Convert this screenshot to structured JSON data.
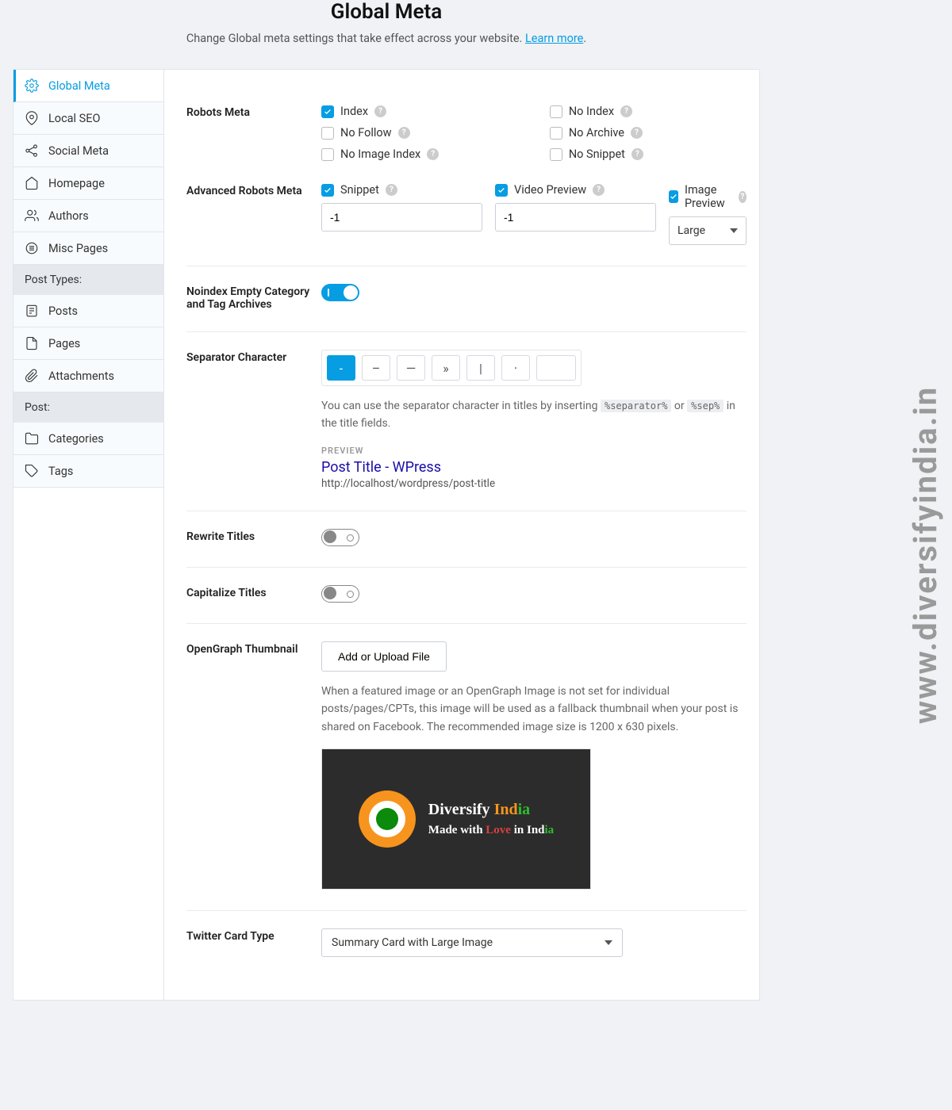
{
  "header": {
    "title": "Global Meta",
    "subtitle": "Change Global meta settings that take effect across your website. ",
    "learn": "Learn more",
    "dot": "."
  },
  "watermark": "www.diversifyindia.in",
  "sidebar": {
    "items": [
      {
        "label": "Global Meta"
      },
      {
        "label": "Local SEO"
      },
      {
        "label": "Social Meta"
      },
      {
        "label": "Homepage"
      },
      {
        "label": "Authors"
      },
      {
        "label": "Misc Pages"
      }
    ],
    "postTypesHeader": "Post Types:",
    "postTypes": [
      {
        "label": "Posts"
      },
      {
        "label": "Pages"
      },
      {
        "label": "Attachments"
      }
    ],
    "postHeader": "Post:",
    "post": [
      {
        "label": "Categories"
      },
      {
        "label": "Tags"
      }
    ]
  },
  "robots": {
    "label": "Robots Meta",
    "items": [
      {
        "label": "Index",
        "checked": true
      },
      {
        "label": "No Index",
        "checked": false
      },
      {
        "label": "No Follow",
        "checked": false
      },
      {
        "label": "No Archive",
        "checked": false
      },
      {
        "label": "No Image Index",
        "checked": false
      },
      {
        "label": "No Snippet",
        "checked": false
      }
    ]
  },
  "adv": {
    "label": "Advanced Robots Meta",
    "cols": [
      {
        "label": "Snippet",
        "value": "-1",
        "type": "text"
      },
      {
        "label": "Video Preview",
        "value": "-1",
        "type": "text"
      },
      {
        "label": "Image Preview",
        "value": "Large",
        "type": "select"
      }
    ]
  },
  "noindex": {
    "label": "Noindex Empty Category and Tag Archives"
  },
  "separator": {
    "label": "Separator Character",
    "opts": [
      "-",
      "–",
      "—",
      "»",
      "|",
      "·",
      ""
    ],
    "desc1": "You can use the separator character in titles by inserting ",
    "code1": "%separator%",
    "or": " or ",
    "code2": "%sep%",
    "desc2": " in the title fields.",
    "previewLabel": "PREVIEW",
    "previewTitle": "Post Title - WPress",
    "previewUrl": "http://localhost/wordpress/post-title"
  },
  "rewrite": {
    "label": "Rewrite Titles"
  },
  "capitalize": {
    "label": "Capitalize Titles"
  },
  "og": {
    "label": "OpenGraph Thumbnail",
    "button": "Add or Upload File",
    "desc": "When a featured image or an OpenGraph Image is not set for individual posts/pages/CPTs, this image will be used as a fallback thumbnail when your post is shared on Facebook. The recommended image size is 1200 x 630 pixels.",
    "thumb": {
      "brand1a": "Diversify ",
      "brand1b": "Ind",
      "brand1c": "ia",
      "brand2a": "Made with ",
      "brand2b": "Love",
      "brand2c": " in ",
      "brand2d": "Ind",
      "brand2e": "ia"
    }
  },
  "twitter": {
    "label": "Twitter Card Type",
    "value": "Summary Card with Large Image"
  }
}
